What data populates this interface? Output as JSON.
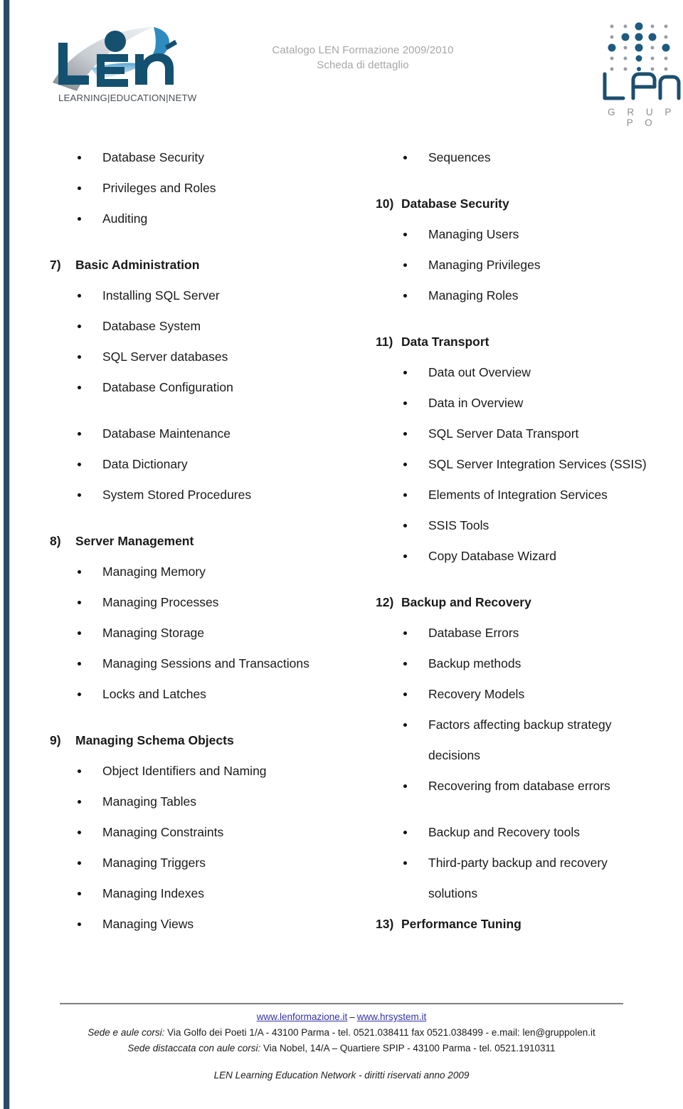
{
  "document": {
    "header": {
      "title_line1": "Catalogo LEN Formazione 2009/2010",
      "title_line2": "Scheda di dettaglio",
      "logo_left_tagline": "LEARNING|EDUCATION|NETWORK",
      "logo_left_wordmark": "LEN",
      "logo_right_wordmark": "LEN",
      "logo_right_subtext": "G R U P P O"
    },
    "colors": {
      "accent_navy": "#1d4e6e",
      "rule_navy": "#2b4a6b",
      "title_gray": "#a6a6a6",
      "dot_gray": "#8a8d90",
      "link_blue": "#3333aa"
    },
    "left_column": [
      {
        "type": "bullet",
        "text": "Database Security"
      },
      {
        "type": "bullet",
        "text": "Privileges and Roles"
      },
      {
        "type": "bullet",
        "text": "Auditing"
      },
      {
        "type": "spacer",
        "text": ""
      },
      {
        "type": "heading",
        "num": "7)",
        "text": "Basic Administration"
      },
      {
        "type": "bullet",
        "text": "Installing SQL Server"
      },
      {
        "type": "bullet",
        "text": "Database System"
      },
      {
        "type": "bullet",
        "text": "SQL Server databases"
      },
      {
        "type": "bullet",
        "text": "Database Configuration"
      },
      {
        "type": "spacer",
        "text": ""
      },
      {
        "type": "bullet",
        "text": "Database Maintenance"
      },
      {
        "type": "bullet",
        "text": "Data Dictionary"
      },
      {
        "type": "bullet",
        "text": "System Stored Procedures"
      },
      {
        "type": "spacer",
        "text": ""
      },
      {
        "type": "heading",
        "num": "8)",
        "text": "Server Management"
      },
      {
        "type": "bullet",
        "text": "Managing Memory"
      },
      {
        "type": "bullet",
        "text": "Managing Processes"
      },
      {
        "type": "bullet",
        "text": "Managing Storage"
      },
      {
        "type": "bullet",
        "text": "Managing Sessions and Transactions"
      },
      {
        "type": "bullet",
        "text": "Locks and Latches"
      },
      {
        "type": "spacer",
        "text": ""
      },
      {
        "type": "heading",
        "num": "9)",
        "text": "Managing Schema Objects"
      },
      {
        "type": "bullet",
        "text": "Object Identifiers and Naming"
      },
      {
        "type": "bullet",
        "text": "Managing Tables"
      },
      {
        "type": "bullet",
        "text": "Managing Constraints"
      },
      {
        "type": "bullet",
        "text": "Managing Triggers"
      },
      {
        "type": "bullet",
        "text": "Managing Indexes"
      },
      {
        "type": "bullet",
        "text": "Managing Views"
      }
    ],
    "right_column": [
      {
        "type": "bullet",
        "text": "Sequences"
      },
      {
        "type": "spacer",
        "text": ""
      },
      {
        "type": "heading",
        "num": "10)",
        "text": "Database Security"
      },
      {
        "type": "bullet",
        "text": "Managing Users"
      },
      {
        "type": "bullet",
        "text": "Managing Privileges"
      },
      {
        "type": "bullet",
        "text": "Managing Roles"
      },
      {
        "type": "spacer",
        "text": ""
      },
      {
        "type": "heading",
        "num": "11)",
        "text": "Data Transport"
      },
      {
        "type": "bullet",
        "text": "Data out Overview"
      },
      {
        "type": "bullet",
        "text": "Data in Overview"
      },
      {
        "type": "bullet",
        "text": "SQL Server Data Transport"
      },
      {
        "type": "bullet",
        "text": "SQL Server Integration Services (SSIS)"
      },
      {
        "type": "bullet",
        "text": "Elements of Integration Services"
      },
      {
        "type": "bullet",
        "text": "SSIS Tools"
      },
      {
        "type": "bullet",
        "text": "Copy Database Wizard"
      },
      {
        "type": "spacer",
        "text": ""
      },
      {
        "type": "heading",
        "num": "12)",
        "text": "Backup and Recovery"
      },
      {
        "type": "bullet",
        "text": "Database Errors"
      },
      {
        "type": "bullet",
        "text": "Backup methods"
      },
      {
        "type": "bullet",
        "text": "Recovery Models"
      },
      {
        "type": "bullet",
        "text": "Factors affecting backup strategy"
      },
      {
        "type": "cont",
        "text": "decisions"
      },
      {
        "type": "bullet",
        "text": "Recovering from database errors"
      },
      {
        "type": "spacer",
        "text": ""
      },
      {
        "type": "bullet",
        "text": "Backup and Recovery tools"
      },
      {
        "type": "bullet",
        "text": "Third-party backup and recovery"
      },
      {
        "type": "cont",
        "text": "solutions"
      },
      {
        "type": "heading",
        "num": "13)",
        "text": "Performance Tuning"
      }
    ],
    "footer": {
      "link1": "www.lenformazione.it",
      "separator": "–",
      "link2": "www.hrsystem.it",
      "address_label_1": "Sede e aule corsi:",
      "address_text_1": " Via Golfo dei Poeti 1/A - 43100 Parma -  tel. 0521.038411 fax 0521.038499 - e.mail: len@gruppolen.it",
      "address_label_2": "Sede distaccata con aule corsi:",
      "address_text_2": " Via  Nobel, 14/A – Quartiere SPIP - 43100 Parma - tel. 0521.1910311",
      "copyright": "LEN Learning Education Network  - diritti riservati anno 2009"
    }
  },
  "dot_matrix": {
    "cols": 5,
    "rows": 5,
    "cells": [
      {
        "c": 0,
        "r": 0,
        "s": 5,
        "color": "#9a9ea3"
      },
      {
        "c": 1,
        "r": 0,
        "s": 5,
        "color": "#9a9ea3"
      },
      {
        "c": 2,
        "r": 0,
        "s": 11,
        "color": "#1d5a80"
      },
      {
        "c": 3,
        "r": 0,
        "s": 5,
        "color": "#9a9ea3"
      },
      {
        "c": 4,
        "r": 0,
        "s": 5,
        "color": "#9a9ea3"
      },
      {
        "c": 0,
        "r": 1,
        "s": 5,
        "color": "#9a9ea3"
      },
      {
        "c": 1,
        "r": 1,
        "s": 11,
        "color": "#1d5a80"
      },
      {
        "c": 2,
        "r": 1,
        "s": 11,
        "color": "#1d5a80"
      },
      {
        "c": 3,
        "r": 1,
        "s": 11,
        "color": "#1d5a80"
      },
      {
        "c": 4,
        "r": 1,
        "s": 5,
        "color": "#9a9ea3"
      },
      {
        "c": 0,
        "r": 2,
        "s": 11,
        "color": "#1d5a80"
      },
      {
        "c": 1,
        "r": 2,
        "s": 5,
        "color": "#9a9ea3"
      },
      {
        "c": 2,
        "r": 2,
        "s": 11,
        "color": "#1d5a80"
      },
      {
        "c": 3,
        "r": 2,
        "s": 5,
        "color": "#9a9ea3"
      },
      {
        "c": 4,
        "r": 2,
        "s": 11,
        "color": "#1d5a80"
      },
      {
        "c": 0,
        "r": 3,
        "s": 5,
        "color": "#9a9ea3"
      },
      {
        "c": 1,
        "r": 3,
        "s": 5,
        "color": "#9a9ea3"
      },
      {
        "c": 2,
        "r": 3,
        "s": 9,
        "color": "#1d5a80"
      },
      {
        "c": 3,
        "r": 3,
        "s": 5,
        "color": "#9a9ea3"
      },
      {
        "c": 4,
        "r": 3,
        "s": 5,
        "color": "#9a9ea3"
      },
      {
        "c": 0,
        "r": 4,
        "s": 5,
        "color": "#9a9ea3"
      },
      {
        "c": 1,
        "r": 4,
        "s": 5,
        "color": "#9a9ea3"
      },
      {
        "c": 2,
        "r": 4,
        "s": 6,
        "color": "#1d5a80"
      },
      {
        "c": 3,
        "r": 4,
        "s": 5,
        "color": "#9a9ea3"
      },
      {
        "c": 4,
        "r": 4,
        "s": 5,
        "color": "#9a9ea3"
      }
    ]
  }
}
